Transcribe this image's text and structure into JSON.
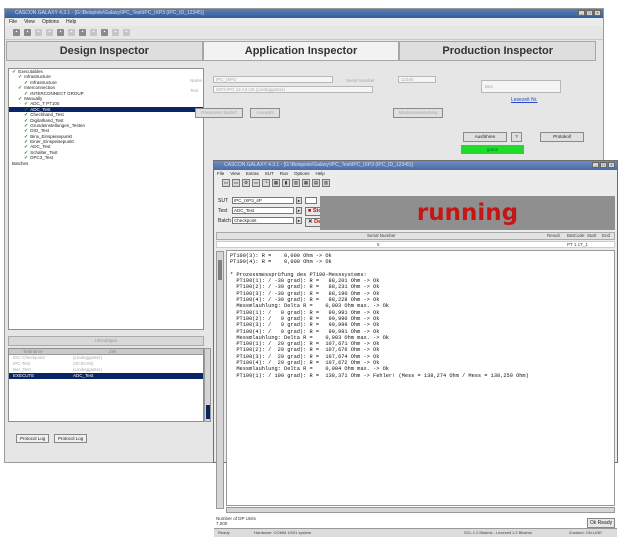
{
  "main_window": {
    "title": "CASCON GALAXY 4.3.1 - [G:\\Beispiele\\Galaxy\\IPC_Test\\IPC_IXP3 (IPC_ID_12345)]",
    "menu": [
      "File",
      "View",
      "Options",
      "Help"
    ],
    "tabs": [
      "Design Inspector",
      "Application Inspector",
      "Production Inspector"
    ],
    "tree": [
      {
        "label": "Executables",
        "level": 0,
        "check": true
      },
      {
        "label": "Infrastructure",
        "level": 1,
        "check": true
      },
      {
        "label": "Infrastructure",
        "level": 2,
        "check": true
      },
      {
        "label": "Interconnection",
        "level": 1,
        "check": true
      },
      {
        "label": "INTERCONNECT GROUP",
        "level": 2,
        "check": true
      },
      {
        "label": "Manually",
        "level": 1,
        "check": true
      },
      {
        "label": "ADC_T PT100",
        "level": 2,
        "check": true
      },
      {
        "label": "ADC_Test",
        "level": 2,
        "check": true,
        "selected": true
      },
      {
        "label": "Checkhand_Test",
        "level": 2,
        "check": true
      },
      {
        "label": "Digitalhand_Test",
        "level": 2,
        "check": true
      },
      {
        "label": "Grundeinstellungen_Testen",
        "level": 2,
        "check": true
      },
      {
        "label": "DIO_Test",
        "level": 2,
        "check": true
      },
      {
        "label": "Binx_Einspeisepunkt",
        "level": 2,
        "check": true
      },
      {
        "label": "Einer_Einspeisepunkt",
        "level": 2,
        "check": true
      },
      {
        "label": "ADC_Test",
        "level": 2,
        "check": true
      },
      {
        "label": "Schalter_Test",
        "level": 2,
        "check": true
      },
      {
        "label": "DPC3_Test",
        "level": 2,
        "check": true
      },
      {
        "label": "Batches",
        "level": 0,
        "check": false
      }
    ],
    "tree_button": "Hinzufügen",
    "form": {
      "label_name": "Name",
      "name_value": "IPC_IXP3",
      "label_text": "Text",
      "text_value": "IXP3 IPC 12 A4 US (Lindeggaster)",
      "label_serial": "Serial Number",
      "serial_value": "12345",
      "btn_1": "Parameter Bedarf",
      "btn_2": "Auswahl",
      "btn_right": "Maskenanwendung",
      "select_value": "Ben",
      "link": "Lesezeit Nr."
    },
    "buttons": {
      "execute": "Ausführen",
      "help": "?",
      "protocol": "Protokoll"
    },
    "status_green": "gotos",
    "log_headers": [
      "Testname",
      "Zeit"
    ],
    "log_rows": [
      {
        "c1": "IDC-Checkpoint",
        "c2": "(Lindeggaster)",
        "selected": false
      },
      {
        "c1": "IPC-Test",
        "c2": "(00:00:00)",
        "selected": false
      },
      {
        "c1": "Ber_Test",
        "c2": "(Lindeggaster)",
        "selected": false
      },
      {
        "c1": "EXECUTE",
        "c2": "ADC_Test",
        "selected": true
      }
    ],
    "bottom_tabs": [
      "Protocol Log",
      "Protocol Log"
    ]
  },
  "test_window": {
    "title": "CASCON GALAXY 4.3.1 - [G:\\Beispiele\\Galaxy\\IPC_Test\\IPC_IXP3 (IPC_ID_12345)]",
    "menu": [
      "File",
      "View",
      "Extras",
      "SUT",
      "Run",
      "Options",
      "Help"
    ],
    "sut_label": "SUT",
    "sut_value": "IPC_IXP3_4P",
    "test_label": "Test",
    "test_value": "ADC_Test",
    "batch_label": "Batch",
    "batch_value": "Checkpoint",
    "stop_label": "Stop",
    "debug_label": "Debug",
    "stop_icon": "stop-icon",
    "debug_icon": "bug-icon",
    "status_text": "running",
    "grid_headers": [
      "Serial Number",
      "Result",
      "BatCode",
      "Start",
      "End"
    ],
    "grid_row": [
      "5",
      "",
      "PT 1.1T_1",
      "",
      ""
    ],
    "output_lines": [
      "PT100(3): R =    0,000 Ohm -> Ok",
      "PT100(4): R =    0,000 Ohm -> Ok",
      "",
      "* Prozessmessprüfung des PT100-Messsystems:",
      "  PT100(1): / -30 grad): R =   88,201 Ohm -> Ok",
      "  PT100(2): / -30 grad): R =   88,231 Ohm -> Ok",
      "  PT100(3): / -30 grad): R =   88,190 Ohm -> Ok",
      "  PT100(4): / -30 grad): R =   88,228 Ohm -> Ok",
      "  Messmlauhlung: Delta R =    0,003 Ohm max. -> Ok",
      "  PT100(1): /   0 grad): R =   99,991 Ohm -> Ok",
      "  PT100(2): /   0 grad): R =   99,990 Ohm -> Ok",
      "  PT100(3): /   0 grad): R =   99,999 Ohm -> Ok",
      "  PT100(4): /   0 grad): R =   99,991 Ohm -> Ok",
      "  Messmlauhlung: Delta R =    0,003 Ohm max. -> Ok",
      "  PT100(1): /  20 grad): R =  107,671 Ohm -> Ok",
      "  PT100(2): /  20 grad): R =  107,676 Ohm -> Ok",
      "  PT100(3): /  20 grad): R =  107,674 Ohm -> Ok",
      "  PT100(4): /  20 grad): R =  107,672 Ohm -> Ok",
      "  Messmlauhlung: Delta R =    0,004 Ohm max. -> Ok",
      "  PT100(1): / 100 grad): R =  138,371 Ohm -> Fehler! (Mess = 138,274 Ohm / Mess = 138,250 Ohm)"
    ],
    "footer_label": "Number of DP Units",
    "footer_value": "7,000",
    "ok_button": "Ok Ready",
    "status_left": "Ready",
    "status_mid": "Hardware: COMM 1/001 system",
    "status_right_1": "SCL 1.2 Bitalms - Lesezeit 1.2 Bitalms",
    "status_right_2": "Zustand: ON-LINE"
  }
}
